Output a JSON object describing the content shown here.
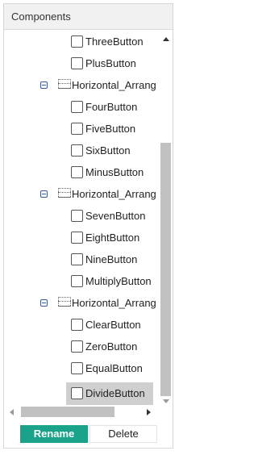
{
  "panel": {
    "title": "Components"
  },
  "tree": {
    "items": [
      {
        "kind": "component",
        "label": "ThreeButton"
      },
      {
        "kind": "component",
        "label": "PlusButton"
      },
      {
        "kind": "arrangement",
        "label": "Horizontal_Arrang",
        "expanded": true
      },
      {
        "kind": "component",
        "label": "FourButton"
      },
      {
        "kind": "component",
        "label": "FiveButton"
      },
      {
        "kind": "component",
        "label": "SixButton"
      },
      {
        "kind": "component",
        "label": "MinusButton"
      },
      {
        "kind": "arrangement",
        "label": "Horizontal_Arrang",
        "expanded": true
      },
      {
        "kind": "component",
        "label": "SevenButton"
      },
      {
        "kind": "component",
        "label": "EightButton"
      },
      {
        "kind": "component",
        "label": "NineButton"
      },
      {
        "kind": "component",
        "label": "MultiplyButton"
      },
      {
        "kind": "arrangement",
        "label": "Horizontal_Arrang",
        "expanded": true
      },
      {
        "kind": "component",
        "label": "ClearButton"
      },
      {
        "kind": "component",
        "label": "ZeroButton"
      },
      {
        "kind": "component",
        "label": "EqualButton"
      },
      {
        "kind": "component",
        "label": "DivideButton",
        "selected": true
      }
    ]
  },
  "actions": {
    "rename_label": "Rename",
    "delete_label": "Delete"
  },
  "colors": {
    "rename_bg": "#1aa38a",
    "selection_bg": "#cfcfcf"
  }
}
